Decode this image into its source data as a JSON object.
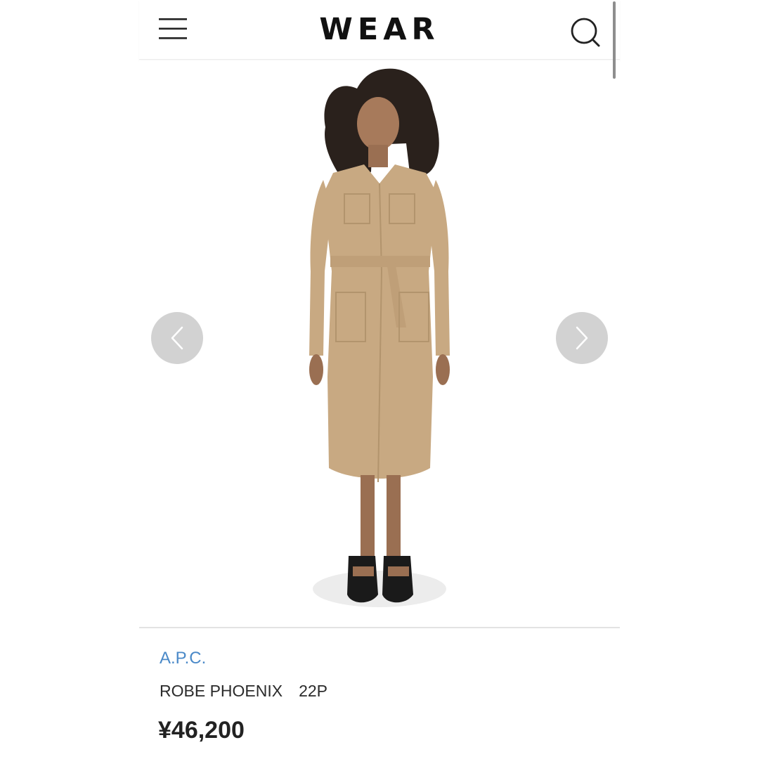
{
  "header": {
    "logo": "WEAR",
    "menu_icon": "hamburger-menu-icon",
    "search_icon": "search-icon"
  },
  "gallery": {
    "prev_icon": "chevron-left-icon",
    "next_icon": "chevron-right-icon"
  },
  "product": {
    "brand": "A.P.C.",
    "name": "ROBE PHOENIX　22P",
    "price": "¥46,200"
  },
  "colors": {
    "brand_link": "#4a89c8",
    "text": "#2b2b2b",
    "arrow_bg": "#d2d2d2",
    "dress": "#c8a982"
  }
}
